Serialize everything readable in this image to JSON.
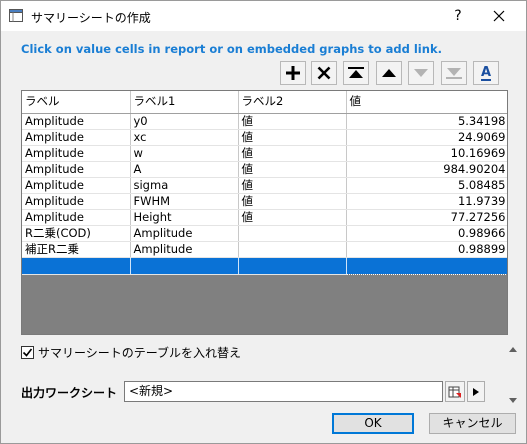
{
  "window": {
    "title": "サマリーシートの作成",
    "help_label": "?"
  },
  "hint": "Click on value cells in report or on embedded graphs to add link.",
  "toolbar": {
    "buttons": [
      "add-icon",
      "delete-icon",
      "move-top-icon",
      "move-up-icon",
      "move-down-icon",
      "move-bottom-icon",
      "rename-icon"
    ],
    "rename_label": "A"
  },
  "table": {
    "headers": [
      "ラベル",
      "ラベル1",
      "ラベル2",
      "値"
    ],
    "rows": [
      [
        "Amplitude",
        "y0",
        "値",
        "5.34198"
      ],
      [
        "Amplitude",
        "xc",
        "値",
        "24.9069"
      ],
      [
        "Amplitude",
        "w",
        "値",
        "10.16969"
      ],
      [
        "Amplitude",
        "A",
        "値",
        "984.90204"
      ],
      [
        "Amplitude",
        "sigma",
        "値",
        "5.08485"
      ],
      [
        "Amplitude",
        "FWHM",
        "値",
        "11.9739"
      ],
      [
        "Amplitude",
        "Height",
        "値",
        "77.27256"
      ],
      [
        "R二乗(COD)",
        "Amplitude",
        "",
        "0.98966"
      ],
      [
        "補正R二乗",
        "Amplitude",
        "",
        "0.98899"
      ]
    ]
  },
  "transpose_checkbox": {
    "label": "サマリーシートのテーブルを入れ替え",
    "checked": true
  },
  "output": {
    "label": "出力ワークシート",
    "value": "<新規>"
  },
  "buttons": {
    "ok": "OK",
    "cancel": "キャンセル"
  },
  "colors": {
    "hint": "#1a7ed4",
    "selection": "#0a72d6",
    "grid_empty": "#808080"
  }
}
